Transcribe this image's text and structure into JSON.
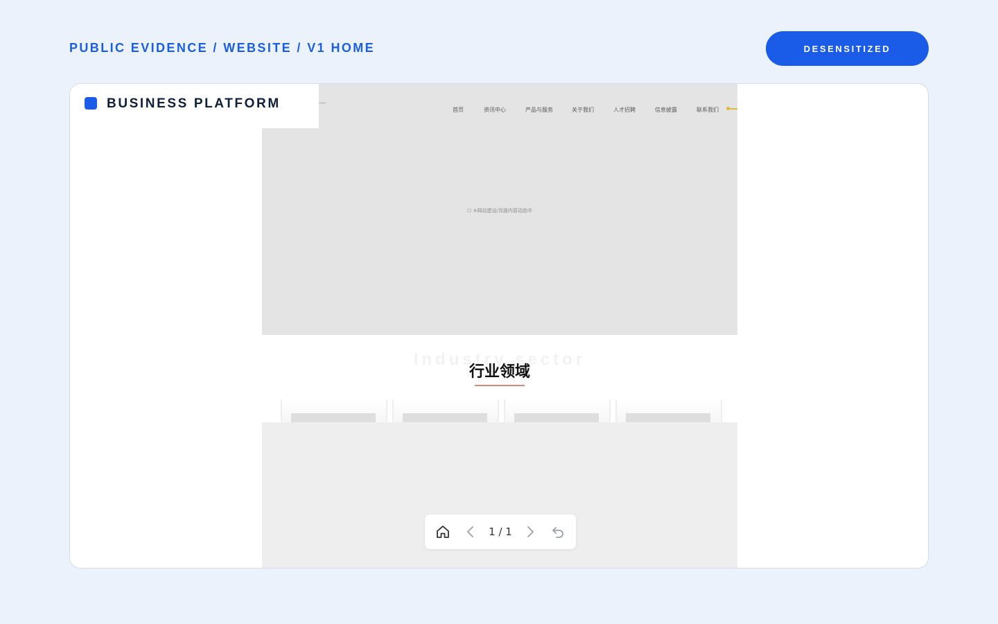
{
  "header": {
    "breadcrumb": "PUBLIC EVIDENCE / WEBSITE / V1 HOME",
    "badge": "DESENSITIZED"
  },
  "panel": {
    "label": "BUSINESS PLATFORM",
    "accent_color": "#1a5be8"
  },
  "website": {
    "nav": [
      "首页",
      "资讯中心",
      "产品与服务",
      "关于我们",
      "人才招聘",
      "信息披露",
      "联系我们"
    ],
    "hero_caption": "☐ ※网站建设/页面内容动态中",
    "section_watermark": "Industry sector",
    "section_title": "行业领域",
    "industry_cards": [
      "",
      "",
      "",
      ""
    ]
  },
  "viewer": {
    "page_indicator": "1 / 1",
    "icons": [
      "home-icon",
      "chevron-left-icon",
      "chevron-right-icon",
      "undo-icon"
    ]
  }
}
